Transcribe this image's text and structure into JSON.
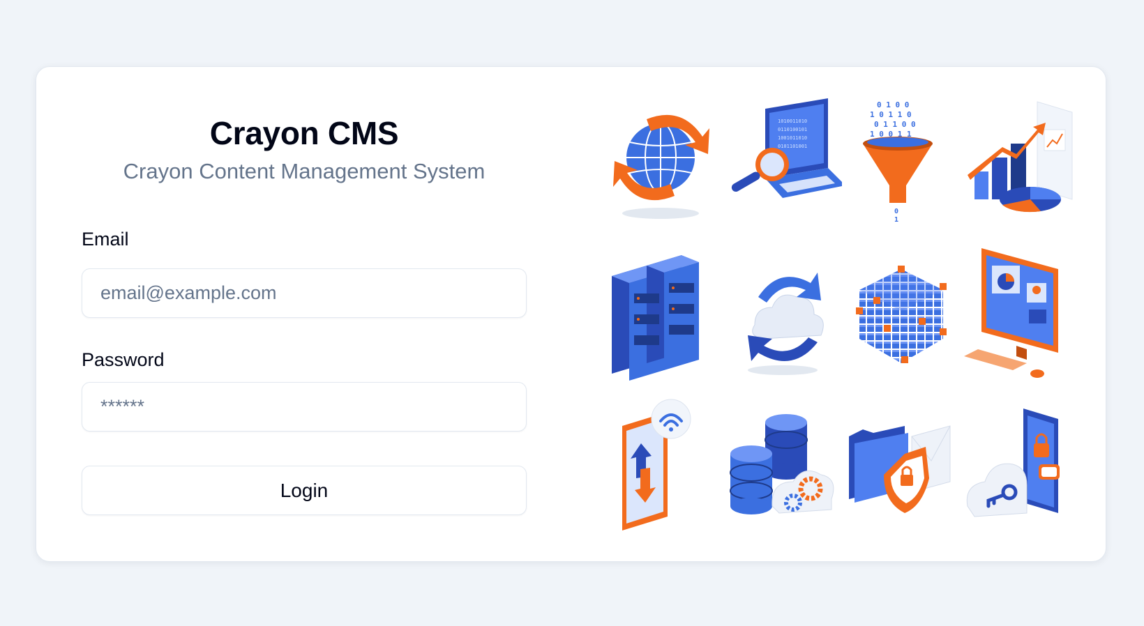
{
  "app": {
    "title": "Crayon CMS",
    "subtitle": "Crayon Content Management System"
  },
  "form": {
    "email_label": "Email",
    "email_placeholder": "email@example.com",
    "password_label": "Password",
    "password_placeholder": "******",
    "login_label": "Login"
  },
  "illustrations": [
    "globe-sync-icon",
    "laptop-search-icon",
    "data-funnel-icon",
    "analytics-chart-icon",
    "server-rack-icon",
    "cloud-sync-icon",
    "data-cube-icon",
    "monitor-dashboard-icon",
    "tablet-transfer-icon",
    "database-settings-icon",
    "secure-folder-icon",
    "cloud-key-phone-icon"
  ],
  "colors": {
    "background": "#f0f4f9",
    "card": "#ffffff",
    "accent_blue": "#3b6fe0",
    "accent_orange": "#f26b1d",
    "text_muted": "#64748b"
  }
}
